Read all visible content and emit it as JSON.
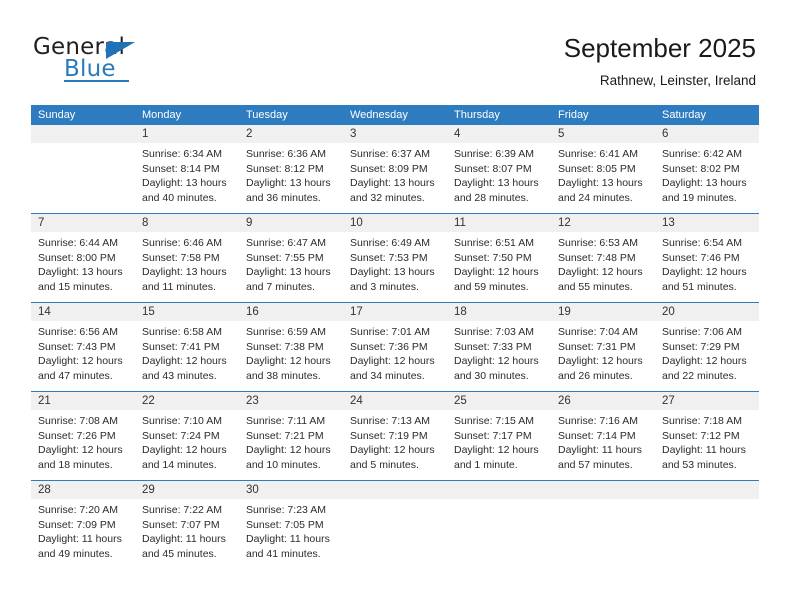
{
  "brand": {
    "name_top": "General",
    "name_bottom": "Blue",
    "accent_color": "#2a7ab9",
    "triangle_icon": "triangle-icon"
  },
  "header": {
    "title": "September 2025",
    "subtitle": "Rathnew, Leinster, Ireland"
  },
  "theme": {
    "header_bar_color": "#2e7cc0",
    "day_strip_color": "#f0f0f0",
    "text_color": "#2b2b2b"
  },
  "weekdays": [
    "Sunday",
    "Monday",
    "Tuesday",
    "Wednesday",
    "Thursday",
    "Friday",
    "Saturday"
  ],
  "weeks": [
    [
      {
        "day": "",
        "empty": true,
        "sunrise": "",
        "sunset": "",
        "daylight_line1": "",
        "daylight_line2": ""
      },
      {
        "day": "1",
        "sunrise": "Sunrise: 6:34 AM",
        "sunset": "Sunset: 8:14 PM",
        "daylight_line1": "Daylight: 13 hours",
        "daylight_line2": "and 40 minutes."
      },
      {
        "day": "2",
        "sunrise": "Sunrise: 6:36 AM",
        "sunset": "Sunset: 8:12 PM",
        "daylight_line1": "Daylight: 13 hours",
        "daylight_line2": "and 36 minutes."
      },
      {
        "day": "3",
        "sunrise": "Sunrise: 6:37 AM",
        "sunset": "Sunset: 8:09 PM",
        "daylight_line1": "Daylight: 13 hours",
        "daylight_line2": "and 32 minutes."
      },
      {
        "day": "4",
        "sunrise": "Sunrise: 6:39 AM",
        "sunset": "Sunset: 8:07 PM",
        "daylight_line1": "Daylight: 13 hours",
        "daylight_line2": "and 28 minutes."
      },
      {
        "day": "5",
        "sunrise": "Sunrise: 6:41 AM",
        "sunset": "Sunset: 8:05 PM",
        "daylight_line1": "Daylight: 13 hours",
        "daylight_line2": "and 24 minutes."
      },
      {
        "day": "6",
        "sunrise": "Sunrise: 6:42 AM",
        "sunset": "Sunset: 8:02 PM",
        "daylight_line1": "Daylight: 13 hours",
        "daylight_line2": "and 19 minutes."
      }
    ],
    [
      {
        "day": "7",
        "sunrise": "Sunrise: 6:44 AM",
        "sunset": "Sunset: 8:00 PM",
        "daylight_line1": "Daylight: 13 hours",
        "daylight_line2": "and 15 minutes."
      },
      {
        "day": "8",
        "sunrise": "Sunrise: 6:46 AM",
        "sunset": "Sunset: 7:58 PM",
        "daylight_line1": "Daylight: 13 hours",
        "daylight_line2": "and 11 minutes."
      },
      {
        "day": "9",
        "sunrise": "Sunrise: 6:47 AM",
        "sunset": "Sunset: 7:55 PM",
        "daylight_line1": "Daylight: 13 hours",
        "daylight_line2": "and 7 minutes."
      },
      {
        "day": "10",
        "sunrise": "Sunrise: 6:49 AM",
        "sunset": "Sunset: 7:53 PM",
        "daylight_line1": "Daylight: 13 hours",
        "daylight_line2": "and 3 minutes."
      },
      {
        "day": "11",
        "sunrise": "Sunrise: 6:51 AM",
        "sunset": "Sunset: 7:50 PM",
        "daylight_line1": "Daylight: 12 hours",
        "daylight_line2": "and 59 minutes."
      },
      {
        "day": "12",
        "sunrise": "Sunrise: 6:53 AM",
        "sunset": "Sunset: 7:48 PM",
        "daylight_line1": "Daylight: 12 hours",
        "daylight_line2": "and 55 minutes."
      },
      {
        "day": "13",
        "sunrise": "Sunrise: 6:54 AM",
        "sunset": "Sunset: 7:46 PM",
        "daylight_line1": "Daylight: 12 hours",
        "daylight_line2": "and 51 minutes."
      }
    ],
    [
      {
        "day": "14",
        "sunrise": "Sunrise: 6:56 AM",
        "sunset": "Sunset: 7:43 PM",
        "daylight_line1": "Daylight: 12 hours",
        "daylight_line2": "and 47 minutes."
      },
      {
        "day": "15",
        "sunrise": "Sunrise: 6:58 AM",
        "sunset": "Sunset: 7:41 PM",
        "daylight_line1": "Daylight: 12 hours",
        "daylight_line2": "and 43 minutes."
      },
      {
        "day": "16",
        "sunrise": "Sunrise: 6:59 AM",
        "sunset": "Sunset: 7:38 PM",
        "daylight_line1": "Daylight: 12 hours",
        "daylight_line2": "and 38 minutes."
      },
      {
        "day": "17",
        "sunrise": "Sunrise: 7:01 AM",
        "sunset": "Sunset: 7:36 PM",
        "daylight_line1": "Daylight: 12 hours",
        "daylight_line2": "and 34 minutes."
      },
      {
        "day": "18",
        "sunrise": "Sunrise: 7:03 AM",
        "sunset": "Sunset: 7:33 PM",
        "daylight_line1": "Daylight: 12 hours",
        "daylight_line2": "and 30 minutes."
      },
      {
        "day": "19",
        "sunrise": "Sunrise: 7:04 AM",
        "sunset": "Sunset: 7:31 PM",
        "daylight_line1": "Daylight: 12 hours",
        "daylight_line2": "and 26 minutes."
      },
      {
        "day": "20",
        "sunrise": "Sunrise: 7:06 AM",
        "sunset": "Sunset: 7:29 PM",
        "daylight_line1": "Daylight: 12 hours",
        "daylight_line2": "and 22 minutes."
      }
    ],
    [
      {
        "day": "21",
        "sunrise": "Sunrise: 7:08 AM",
        "sunset": "Sunset: 7:26 PM",
        "daylight_line1": "Daylight: 12 hours",
        "daylight_line2": "and 18 minutes."
      },
      {
        "day": "22",
        "sunrise": "Sunrise: 7:10 AM",
        "sunset": "Sunset: 7:24 PM",
        "daylight_line1": "Daylight: 12 hours",
        "daylight_line2": "and 14 minutes."
      },
      {
        "day": "23",
        "sunrise": "Sunrise: 7:11 AM",
        "sunset": "Sunset: 7:21 PM",
        "daylight_line1": "Daylight: 12 hours",
        "daylight_line2": "and 10 minutes."
      },
      {
        "day": "24",
        "sunrise": "Sunrise: 7:13 AM",
        "sunset": "Sunset: 7:19 PM",
        "daylight_line1": "Daylight: 12 hours",
        "daylight_line2": "and 5 minutes."
      },
      {
        "day": "25",
        "sunrise": "Sunrise: 7:15 AM",
        "sunset": "Sunset: 7:17 PM",
        "daylight_line1": "Daylight: 12 hours",
        "daylight_line2": "and 1 minute."
      },
      {
        "day": "26",
        "sunrise": "Sunrise: 7:16 AM",
        "sunset": "Sunset: 7:14 PM",
        "daylight_line1": "Daylight: 11 hours",
        "daylight_line2": "and 57 minutes."
      },
      {
        "day": "27",
        "sunrise": "Sunrise: 7:18 AM",
        "sunset": "Sunset: 7:12 PM",
        "daylight_line1": "Daylight: 11 hours",
        "daylight_line2": "and 53 minutes."
      }
    ],
    [
      {
        "day": "28",
        "sunrise": "Sunrise: 7:20 AM",
        "sunset": "Sunset: 7:09 PM",
        "daylight_line1": "Daylight: 11 hours",
        "daylight_line2": "and 49 minutes."
      },
      {
        "day": "29",
        "sunrise": "Sunrise: 7:22 AM",
        "sunset": "Sunset: 7:07 PM",
        "daylight_line1": "Daylight: 11 hours",
        "daylight_line2": "and 45 minutes."
      },
      {
        "day": "30",
        "sunrise": "Sunrise: 7:23 AM",
        "sunset": "Sunset: 7:05 PM",
        "daylight_line1": "Daylight: 11 hours",
        "daylight_line2": "and 41 minutes."
      },
      {
        "day": "",
        "empty": true,
        "sunrise": "",
        "sunset": "",
        "daylight_line1": "",
        "daylight_line2": ""
      },
      {
        "day": "",
        "empty": true,
        "sunrise": "",
        "sunset": "",
        "daylight_line1": "",
        "daylight_line2": ""
      },
      {
        "day": "",
        "empty": true,
        "sunrise": "",
        "sunset": "",
        "daylight_line1": "",
        "daylight_line2": ""
      },
      {
        "day": "",
        "empty": true,
        "sunrise": "",
        "sunset": "",
        "daylight_line1": "",
        "daylight_line2": ""
      }
    ]
  ]
}
